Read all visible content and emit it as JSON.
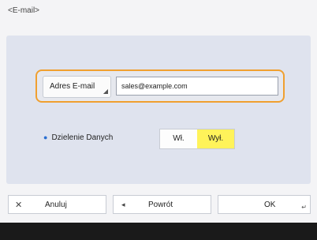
{
  "title": "<E-mail>",
  "email": {
    "button_label": "Adres E-mail",
    "value": "sales@example.com"
  },
  "data_sharing": {
    "label": "Dzielenie Danych",
    "on_label": "Wł.",
    "off_label": "Wył.",
    "selected": "Wył.",
    "selected_color": "#fff35a"
  },
  "buttons": {
    "cancel": "Anuluj",
    "back": "Powrót",
    "ok": "OK"
  },
  "icons": {
    "cancel": "close-icon",
    "back": "arrow-left-icon",
    "corner": "enter-corner-icon"
  },
  "colors": {
    "focus_border": "#f0a030",
    "bullet": "#2a6fd1"
  }
}
